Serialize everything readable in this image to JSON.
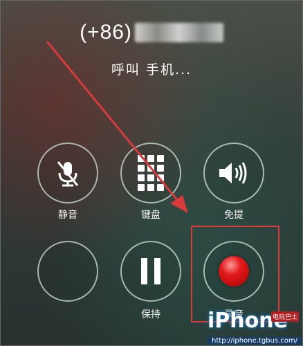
{
  "call": {
    "number_prefix": "(+86)",
    "status": "呼叫 手机..."
  },
  "controls": {
    "mute_label": "静音",
    "keypad_label": "键盘",
    "speaker_label": "免提",
    "hold_label": "保持",
    "record_label": "录音"
  },
  "icons": {
    "mute": "microphone-muted-icon",
    "keypad": "keypad-grid-icon",
    "speaker": "speaker-volume-icon",
    "hold": "pause-icon",
    "record": "record-dot-icon"
  },
  "colors": {
    "annotation_red": "#d63a3a",
    "ring": "#dcf0e1",
    "record": "#e41a1a"
  },
  "watermark": {
    "logo_text": "iPhone",
    "badge": "电玩巴士",
    "url": "http://iphone.tgbus.com/"
  }
}
